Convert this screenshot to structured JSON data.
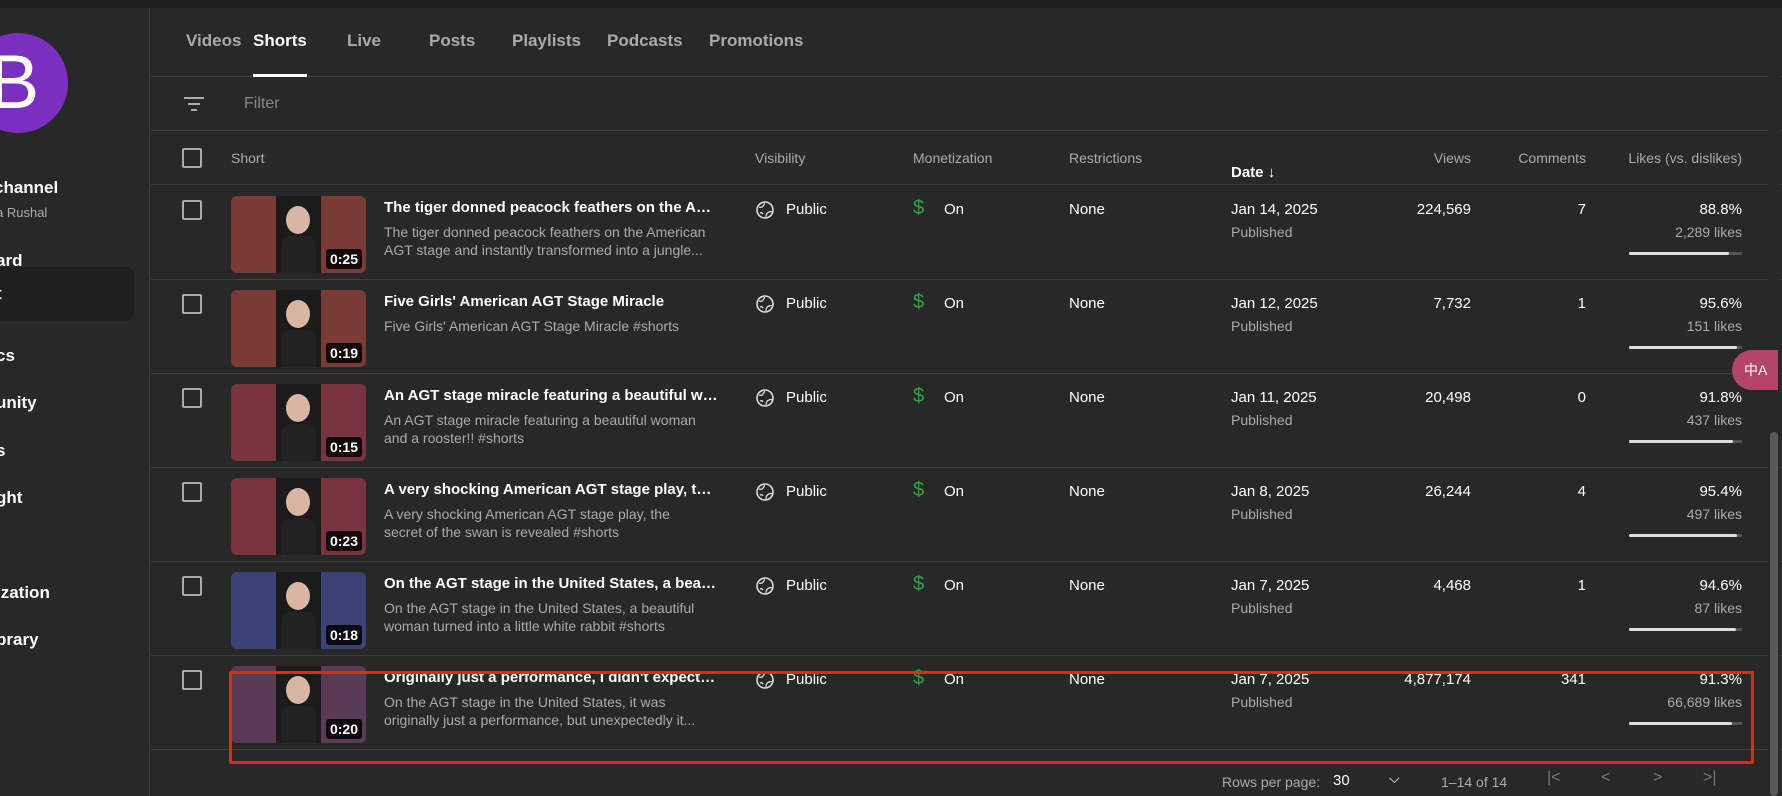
{
  "sidebar": {
    "avatar_letter": "B",
    "channel_name": "channel",
    "channel_handle": "a Rushal",
    "items": [
      {
        "label": "ard"
      },
      {
        "label": "t"
      },
      {
        "label": "cs"
      },
      {
        "label": "unity"
      },
      {
        "label": "s"
      },
      {
        "label": "ght"
      },
      {
        "label": "ization"
      },
      {
        "label": "brary"
      }
    ]
  },
  "tabs": [
    {
      "label": "Videos"
    },
    {
      "label": "Shorts"
    },
    {
      "label": "Live"
    },
    {
      "label": "Posts"
    },
    {
      "label": "Playlists"
    },
    {
      "label": "Podcasts"
    },
    {
      "label": "Promotions"
    }
  ],
  "filter": {
    "placeholder": "Filter"
  },
  "columns": {
    "short": "Short",
    "visibility": "Visibility",
    "monetization": "Monetization",
    "restrictions": "Restrictions",
    "date": "Date",
    "views": "Views",
    "comments": "Comments",
    "likes": "Likes (vs. dislikes)"
  },
  "rows": [
    {
      "duration": "0:25",
      "title": "The tiger donned peacock feathers on the AGT s...",
      "desc": "The tiger donned peacock feathers on the American AGT stage and instantly transformed into a jungle...",
      "visibility": "Public",
      "monetization": "On",
      "restrictions": "None",
      "date": "Jan 14, 2025",
      "status": "Published",
      "views": "224,569",
      "comments": "7",
      "likes_pct": "88.8%",
      "likes_count": "2,289 likes",
      "likes_ratio": 0.888,
      "thumb_color": "#7a3b35"
    },
    {
      "duration": "0:19",
      "title": "Five Girls' American AGT Stage Miracle",
      "desc": "Five Girls' American AGT Stage Miracle #shorts",
      "visibility": "Public",
      "monetization": "On",
      "restrictions": "None",
      "date": "Jan 12, 2025",
      "status": "Published",
      "views": "7,732",
      "comments": "1",
      "likes_pct": "95.6%",
      "likes_count": "151 likes",
      "likes_ratio": 0.956,
      "thumb_color": "#7a3b35"
    },
    {
      "duration": "0:15",
      "title": "An AGT stage miracle featuring a beautiful wom...",
      "desc": "An AGT stage miracle featuring a beautiful woman and a rooster!! #shorts",
      "visibility": "Public",
      "monetization": "On",
      "restrictions": "None",
      "date": "Jan 11, 2025",
      "status": "Published",
      "views": "20,498",
      "comments": "0",
      "likes_pct": "91.8%",
      "likes_count": "437 likes",
      "likes_ratio": 0.918,
      "thumb_color": "#7a3440"
    },
    {
      "duration": "0:23",
      "title": "A very shocking American AGT stage play, the se...",
      "desc": "A very shocking American AGT stage play, the secret of the swan is revealed #shorts",
      "visibility": "Public",
      "monetization": "On",
      "restrictions": "None",
      "date": "Jan 8, 2025",
      "status": "Published",
      "views": "26,244",
      "comments": "4",
      "likes_pct": "95.4%",
      "likes_count": "497 likes",
      "likes_ratio": 0.954,
      "thumb_color": "#7a3440"
    },
    {
      "duration": "0:18",
      "title": "On the AGT stage in the United States, a beautifu...",
      "desc": "On the AGT stage in the United States, a beautiful woman turned into a little white rabbit #shorts",
      "visibility": "Public",
      "monetization": "On",
      "restrictions": "None",
      "date": "Jan 7, 2025",
      "status": "Published",
      "views": "4,468",
      "comments": "1",
      "likes_pct": "94.6%",
      "likes_count": "87 likes",
      "likes_ratio": 0.946,
      "thumb_color": "#3a4276"
    },
    {
      "duration": "0:20",
      "title": "Originally just a performance, I didn't expect it to ...",
      "desc": "On the AGT stage in the United States, it was originally just a performance, but unexpectedly it...",
      "visibility": "Public",
      "monetization": "On",
      "restrictions": "None",
      "date": "Jan 7, 2025",
      "status": "Published",
      "views": "4,877,174",
      "comments": "341",
      "likes_pct": "91.3%",
      "likes_count": "66,689 likes",
      "likes_ratio": 0.913,
      "thumb_color": "#5a3a55"
    }
  ],
  "pagination": {
    "rows_per_page_label": "Rows per page:",
    "rows_per_page": "30",
    "range": "1–14 of 14"
  },
  "translate_badge": "中A",
  "colors": {
    "monetization_on": "#2ba640",
    "highlight": "#e5261c",
    "avatar": "#7b2fbf"
  }
}
